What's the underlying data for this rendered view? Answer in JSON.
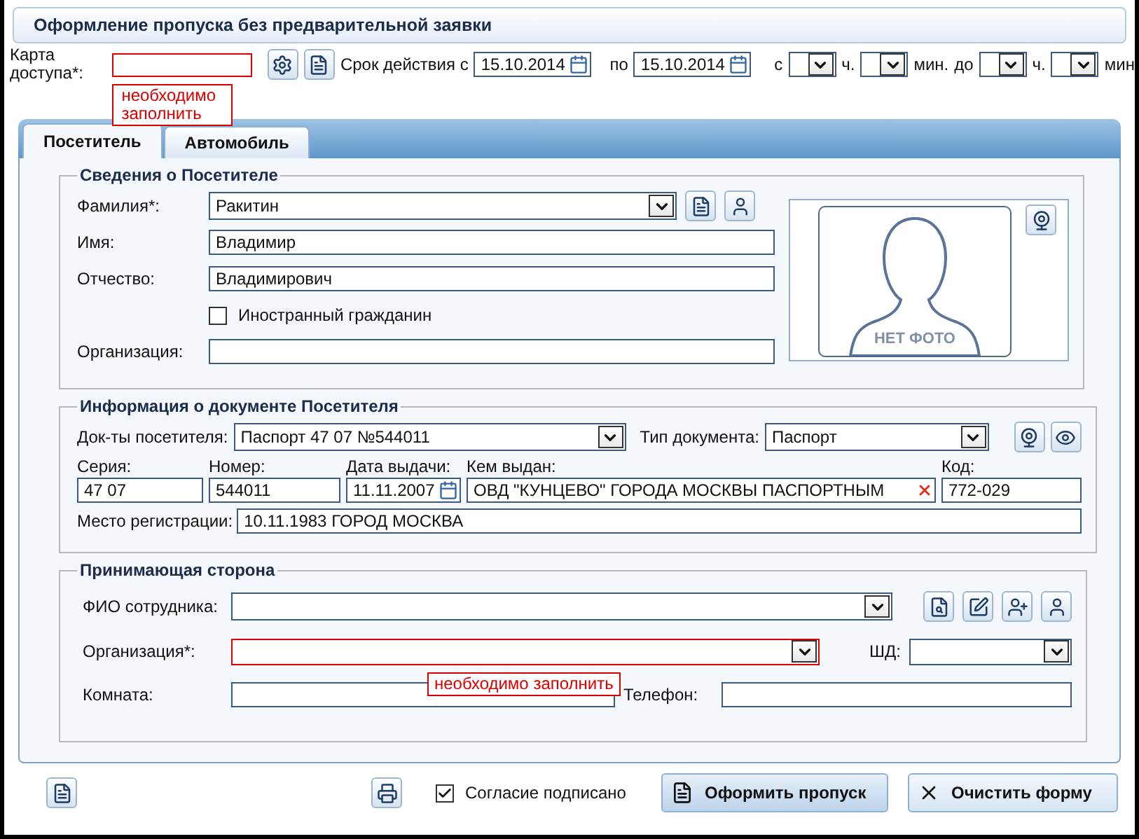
{
  "window": {
    "title": "Оформление пропуска без предварительной заявки"
  },
  "header": {
    "card_label": "Карта доступа*:",
    "card_error": "необходимо заполнить",
    "validity_label": "Срок действия с",
    "date_from": "15.10.2014",
    "to_label": "по",
    "date_to": "15.10.2014",
    "from_time_label": "с",
    "hours_label": "ч.",
    "minutes_label": "мин.",
    "until_label": "до",
    "hours_label_2": "ч.",
    "minutes_label_2": "мин"
  },
  "tabs": [
    {
      "label": "Посетитель",
      "selected": true
    },
    {
      "label": "Автомобиль",
      "selected": false
    }
  ],
  "visitor": {
    "legend": "Сведения о Посетителе",
    "photo_caption": "НЕТ ФОТО",
    "fields": [
      {
        "label": "Фамилия*:",
        "value": "Ракитин",
        "kind": "combo"
      },
      {
        "label": "Имя:",
        "value": "Владимир",
        "kind": "text"
      },
      {
        "label": "Отчество:",
        "value": "Владимирович",
        "kind": "text"
      },
      {
        "label": "Иностранный гражданин",
        "kind": "checkbox",
        "checked": false
      },
      {
        "label": "Организация:",
        "kind": "text"
      }
    ]
  },
  "document": {
    "legend": "Информация о документе Посетителя",
    "docs_label": "Док-ты посетителя:",
    "docs_value": "Паспорт 47 07 №544011",
    "type_label": "Тип документа:",
    "type_value": "Паспорт",
    "registration_label": "Место регистрации:",
    "registration_value": "10.11.1983 ГОРОД МОСКВА",
    "fields": [
      {
        "label": "Серия:",
        "value": "47 07",
        "kind": "text"
      },
      {
        "label": "Номер:",
        "value": "544011",
        "kind": "text"
      },
      {
        "label": "Дата выдачи:",
        "value": "11.11.2007",
        "kind": "date"
      },
      {
        "label": "Кем выдан:",
        "value": "ОВД \"КУНЦЕВО\" ГОРОДА МОСКВЫ ПАСПОРТНЫМ",
        "kind": "clearable"
      },
      {
        "label": "Код:",
        "value": "772-029",
        "kind": "text"
      }
    ]
  },
  "host": {
    "legend": "Принимающая сторона",
    "employee_label": "ФИО сотрудника:",
    "org_label": "Организация*:",
    "org_error": "необходимо заполнить",
    "sd_label": "ШД:",
    "room_label": "Комната:",
    "phone_label": "Телефон:"
  },
  "footer": {
    "consent": {
      "label": "Согласие подписано",
      "checked": true
    },
    "buttons": [
      {
        "label": "Оформить пропуск",
        "kind": "issue"
      },
      {
        "label": "Очистить форму",
        "kind": "clear"
      }
    ]
  }
}
